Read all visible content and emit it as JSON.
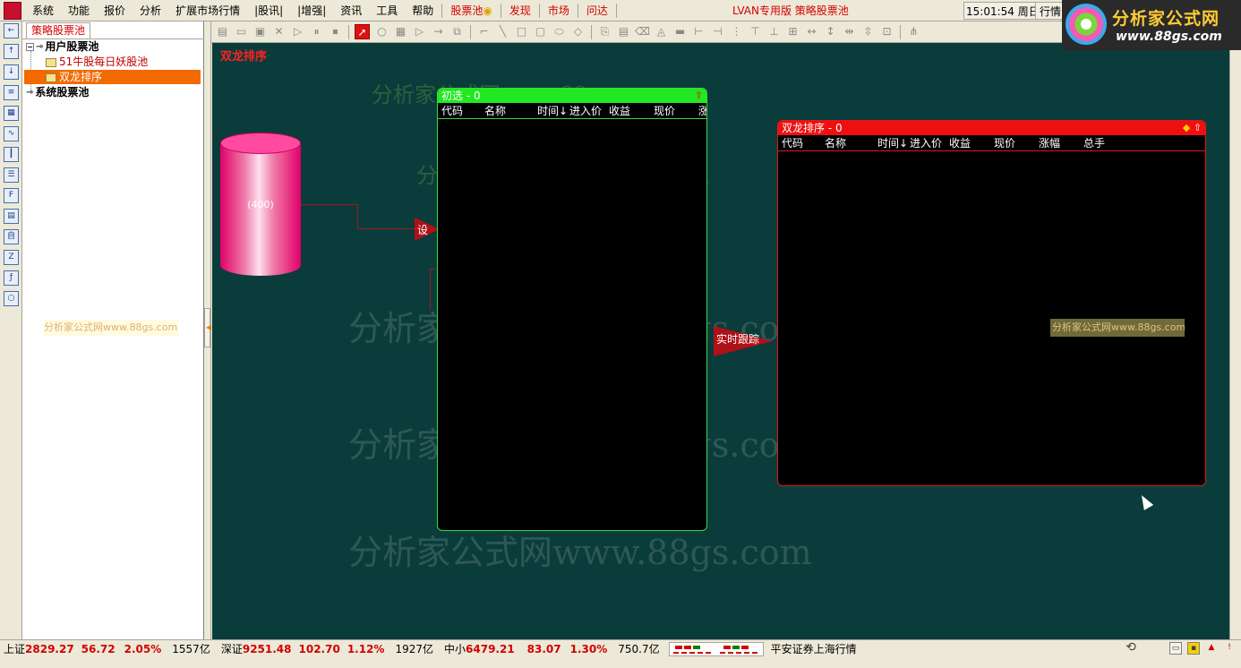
{
  "menu": {
    "items": [
      "系统",
      "功能",
      "报价",
      "分析",
      "扩展市场行情",
      "|股讯|",
      "|增强|",
      "资讯",
      "工具",
      "帮助"
    ],
    "pool_label": "股票池",
    "discover_label": "发现",
    "market_label": "市场",
    "ask_label": "问达",
    "version": "LVAN专用版  策略股票池",
    "clock": "15:01:54 周日",
    "market_button": "行情"
  },
  "brand": {
    "title": "分析家公式网",
    "url": "www.88gs.com"
  },
  "left_toolbar": {
    "icons": [
      "arrow-left-icon",
      "arrow-up-icon",
      "arrow-down-icon",
      "report-icon",
      "grid-icon",
      "line-chart-icon",
      "candle-icon",
      "list-icon",
      "fio-icon",
      "doc-icon",
      "self-icon",
      "fiz-icon",
      "fx-icon",
      "circle-icon"
    ]
  },
  "tree": {
    "tab": "策略股票池",
    "user_pool": "用户股票池",
    "item_51": "51牛股每日妖股池",
    "item_dragon": "双龙排序",
    "system_pool": "系统股票池",
    "watermark": "分析家公式网www.88gs.com"
  },
  "canvas": {
    "title": "双龙排序",
    "watermark_text": "分析家公式网www.88gs.com",
    "watermark_small": "分析家公式网www.88gs.com",
    "cylinder_label": "(400)",
    "arrow_set_label": "设",
    "arrow_track_label": "实时跟踪",
    "canvas_watermark_box": "分析家公式网www.88gs.com"
  },
  "panels": {
    "initial": {
      "title": "初选 - 0",
      "columns": [
        "代码",
        "名称",
        "时间↓",
        "进入价",
        "收益",
        "现价",
        "涨"
      ]
    },
    "sort": {
      "title": "双龙排序 - 0",
      "columns": [
        "代码",
        "名称",
        "时间↓",
        "进入价",
        "收益",
        "现价",
        "涨幅",
        "总手"
      ]
    }
  },
  "status": {
    "sh_label": "上证",
    "sh_index": "2829.27",
    "sh_change": "56.72",
    "sh_pct": "2.05%",
    "sh_volume": "1557亿",
    "sz_label": "深证",
    "sz_index": "9251.48",
    "sz_change": "102.70",
    "sz_pct": "1.12%",
    "sz_volume": "1927亿",
    "zx_label": "中小",
    "zx_index": "6479.21",
    "zx_change": "83.07",
    "zx_pct": "1.30%",
    "zx_volume": "750.7亿",
    "broker": "平安证券上海行情"
  },
  "colors": {
    "canvas_bg": "#0b3c3c",
    "initial_panel": "#22e822",
    "sort_panel": "#ee1010",
    "accent_red": "#d40000",
    "selected_tree": "#f26a00"
  }
}
